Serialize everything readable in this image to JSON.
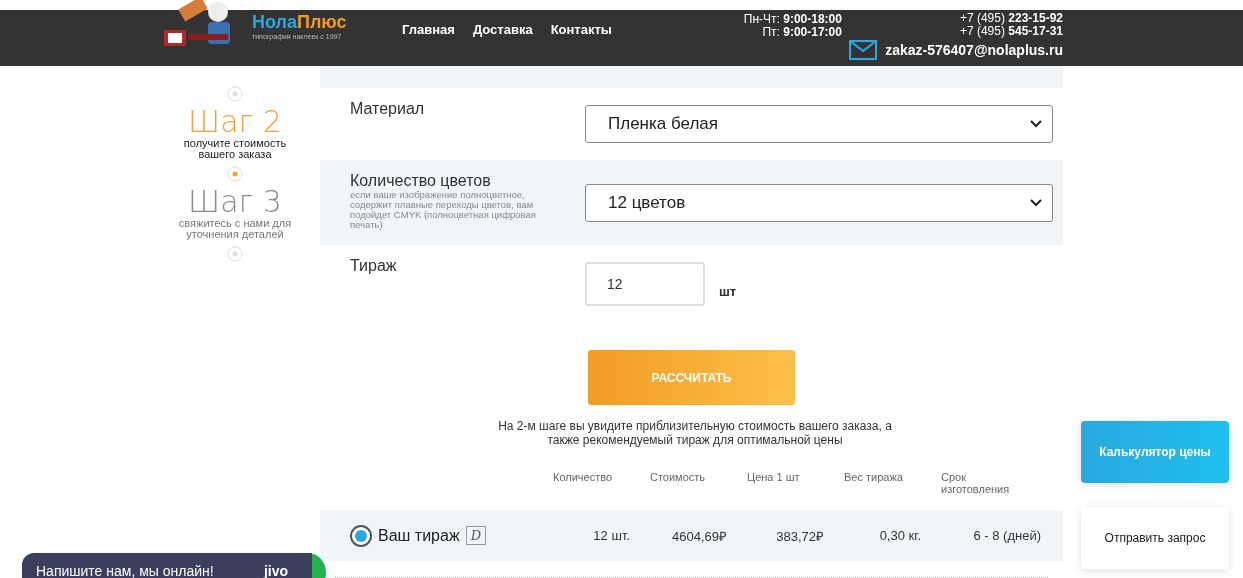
{
  "header": {
    "logo": {
      "name_start": "Нола",
      "name_end": "Плюс",
      "tagline": "типография наклеек с 1997"
    },
    "nav": [
      {
        "label": "Главная"
      },
      {
        "label": "Доставка"
      },
      {
        "label": "Контакты"
      }
    ],
    "hours": [
      "Пн-Чт: **9:00-18:00**",
      "Пт: **9:00-17:00**"
    ],
    "phones": [
      "+7 (495) **223-15-92**",
      "+7 (495) **545-17-31**"
    ],
    "email": "zakaz-576407@nolaplus.ru"
  },
  "steps": [
    {
      "title": "Шаг 2",
      "caption": "получите стоимость вашего заказа",
      "current": true
    },
    {
      "title": "Шаг 3",
      "caption": "свяжитесь с нами для уточнения деталей",
      "current": false
    }
  ],
  "form": {
    "rows": [
      {
        "kind": "select",
        "label": "Материал",
        "value": "Пленка белая"
      },
      {
        "kind": "select",
        "label": "Количество цветов",
        "hint": "если ваше изображение полноцветное, содержит плавные переходы цветов, вам подойдет CMYK (полноцветная цифровая печать)",
        "value": "12 цветов"
      },
      {
        "kind": "quantity",
        "label": "Тираж",
        "value": "12",
        "unit": "шт"
      }
    ],
    "calculate_button": "РАССЧИТАТЬ",
    "note": "На 2-м шаге вы увидите приблизительную стоимость вашего заказа, а также рекомендуемый тираж для оптимальной цены"
  },
  "results": {
    "columns": [
      "Количество",
      "Стоимость",
      "Цена 1 шт",
      "Вес тиража",
      "Срок изготовления"
    ],
    "rows": [
      {
        "label": "Ваш тираж",
        "icon_glyph": "D",
        "selected": true,
        "cells": [
          "12 шт.",
          "4604,69₽",
          "383,72₽",
          "0,30 кг.",
          "6 - 8 (дней)"
        ]
      }
    ]
  },
  "side_buttons": [
    {
      "label": "Калькулятор цены",
      "kind": "primary"
    },
    {
      "label": "Отправить запрос",
      "kind": "secondary"
    }
  ],
  "chat": {
    "text": "Напишите нам, мы онлайн!",
    "brand": "jivo"
  }
}
